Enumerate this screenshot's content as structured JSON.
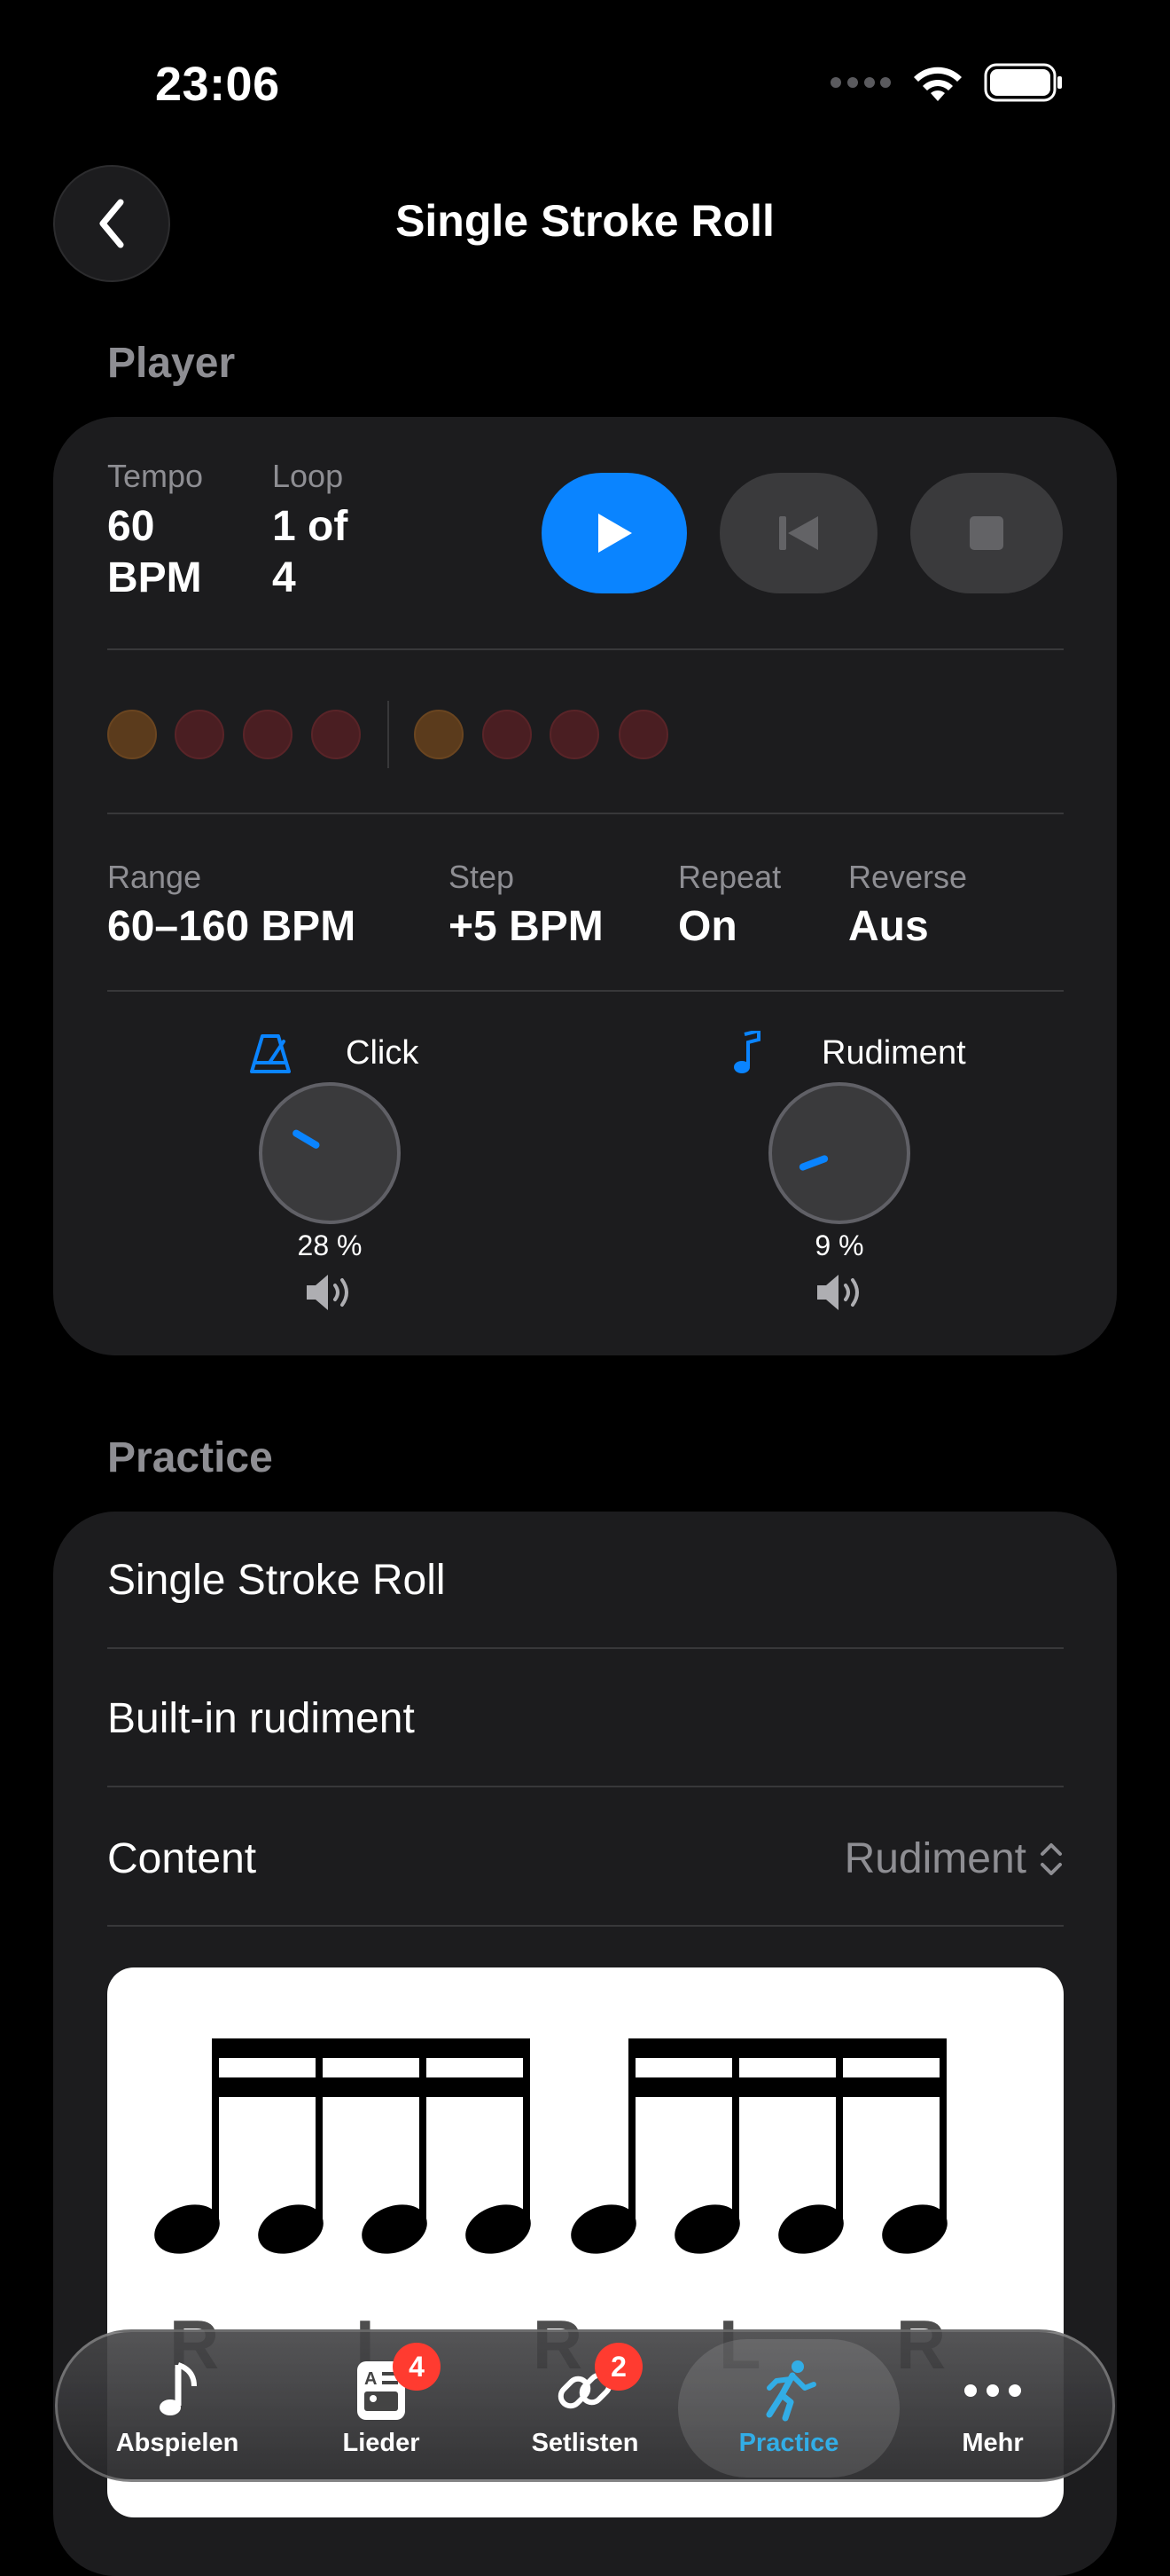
{
  "status": {
    "time": "23:06"
  },
  "nav": {
    "title": "Single Stroke Roll"
  },
  "player": {
    "section_label": "Player",
    "tempo_label": "Tempo",
    "tempo_value_line1": "60",
    "tempo_value_line2": "BPM",
    "loop_label": "Loop",
    "loop_value_line1": "1 of",
    "loop_value_line2": "4",
    "beats": [
      {
        "accent": true
      },
      {
        "accent": false
      },
      {
        "accent": false
      },
      {
        "accent": false
      },
      {
        "accent": true
      },
      {
        "accent": false
      },
      {
        "accent": false
      },
      {
        "accent": false
      }
    ],
    "range_label": "Range",
    "range_value": "60–160 BPM",
    "step_label": "Step",
    "step_value": "+5 BPM",
    "repeat_label": "Repeat",
    "repeat_value": "On",
    "reverse_label": "Reverse",
    "reverse_value": "Aus",
    "click_label": "Click",
    "click_percent": "28 %",
    "click_level": 0.28,
    "rudiment_label": "Rudiment",
    "rudiment_percent": "9 %",
    "rudiment_level": 0.09
  },
  "practice": {
    "section_label": "Practice",
    "title": "Single Stroke Roll",
    "subtitle": "Built-in rudiment",
    "content_label": "Content",
    "content_value": "Rudiment",
    "sticking": "R L R L R L R L"
  },
  "tabbar": {
    "tabs": [
      {
        "label": "Abspielen",
        "icon": "music-note-icon"
      },
      {
        "label": "Lieder",
        "icon": "song-list-icon",
        "badge": "4"
      },
      {
        "label": "Setlisten",
        "icon": "link-icon",
        "badge": "2"
      },
      {
        "label": "Practice",
        "icon": "running-figure-icon",
        "active": true
      },
      {
        "label": "Mehr",
        "icon": "more-dots-icon"
      }
    ]
  },
  "colors": {
    "accent": "#0a84ff",
    "background": "#000000",
    "card": "#1c1c1e",
    "badge": "#ff3b30"
  }
}
